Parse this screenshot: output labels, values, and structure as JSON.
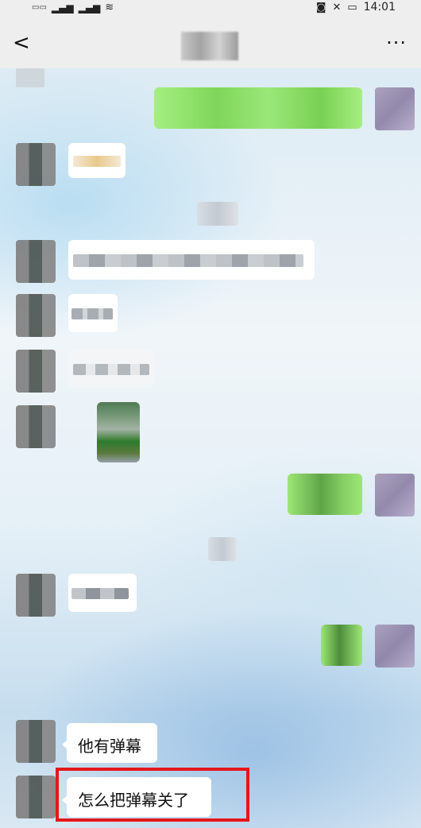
{
  "status_bar": {
    "time": "14:01"
  },
  "nav": {
    "back_label": "<",
    "more_label": "···"
  },
  "messages": {
    "msg1": "他有弹幕",
    "msg2": "怎么把弹幕关了"
  }
}
